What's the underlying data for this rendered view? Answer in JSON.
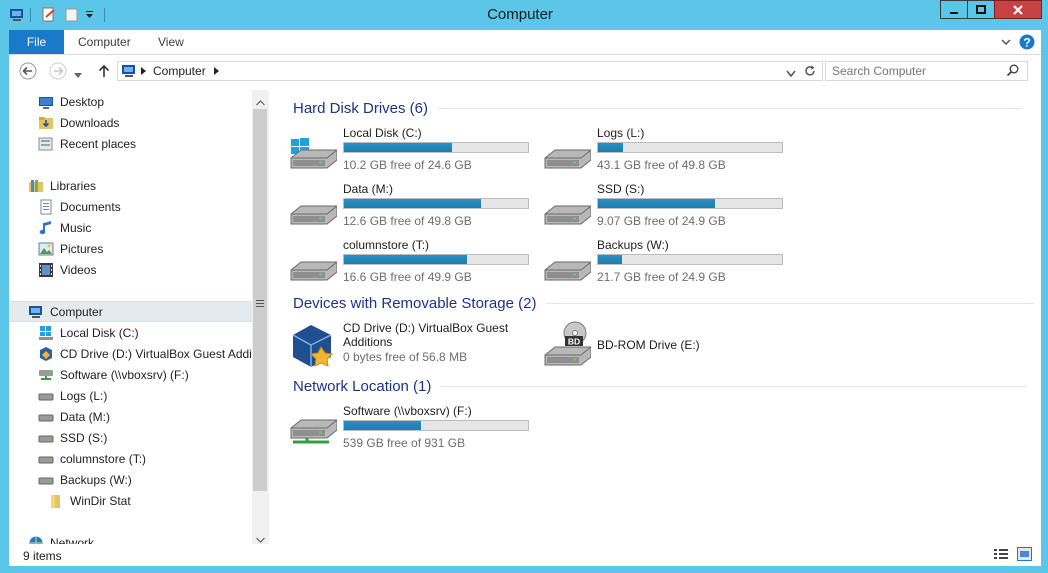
{
  "window": {
    "title": "Computer"
  },
  "ribbon": {
    "file": "File",
    "tabs": [
      "Computer",
      "View"
    ]
  },
  "address": {
    "location": "Computer"
  },
  "search": {
    "placeholder": "Search Computer"
  },
  "nav": {
    "favorites": [
      "Desktop",
      "Downloads",
      "Recent places"
    ],
    "libraries_label": "Libraries",
    "libraries": [
      "Documents",
      "Music",
      "Pictures",
      "Videos"
    ],
    "computer_label": "Computer",
    "drives": [
      "Local Disk (C:)",
      "CD Drive (D:) VirtualBox Guest Additi",
      "Software (\\\\vboxsrv) (F:)",
      "Logs (L:)",
      "Data (M:)",
      "SSD (S:)",
      "columnstore (T:)",
      "Backups (W:)"
    ],
    "subfolder": "WinDir Stat",
    "network_label": "Network"
  },
  "groups": {
    "hdd_title": "Hard Disk Drives (6)",
    "removable_title": "Devices with Removable Storage (2)",
    "network_title": "Network Location (1)"
  },
  "hdd": [
    {
      "name": "Local Disk (C:)",
      "free": "10.2 GB free of 24.6 GB",
      "used_fraction": 0.585
    },
    {
      "name": "Logs (L:)",
      "free": "43.1 GB free of 49.8 GB",
      "used_fraction": 0.135
    },
    {
      "name": "Data (M:)",
      "free": "12.6 GB free of 49.8 GB",
      "used_fraction": 0.747
    },
    {
      "name": "SSD (S:)",
      "free": "9.07 GB free of 24.9 GB",
      "used_fraction": 0.636
    },
    {
      "name": "columnstore (T:)",
      "free": "16.6 GB free of 49.9 GB",
      "used_fraction": 0.667
    },
    {
      "name": "Backups (W:)",
      "free": "21.7 GB free of 24.9 GB",
      "used_fraction": 0.129
    }
  ],
  "removable": [
    {
      "name_line1": "CD Drive (D:) VirtualBox Guest",
      "name_line2": "Additions",
      "free": "0 bytes free of 56.8 MB"
    },
    {
      "name": "BD-ROM Drive (E:)",
      "badge": "BD"
    }
  ],
  "network": [
    {
      "name": "Software (\\\\vboxsrv) (F:)",
      "free": "539 GB free of 931 GB",
      "used_fraction": 0.421
    }
  ],
  "status": {
    "items": "9 items"
  },
  "colors": {
    "accent": "#1979ca",
    "frame": "#5bc6e8",
    "bar_fill": "#1a7fb0",
    "group_title": "#1e3287"
  },
  "icons": [
    "computer-icon",
    "properties-icon",
    "new-folder-icon",
    "dropdown-icon",
    "minimize-icon",
    "maximize-icon",
    "close-icon",
    "help-icon",
    "back-icon",
    "forward-icon",
    "up-icon",
    "refresh-icon",
    "search-icon",
    "hard-drive-icon",
    "dvd-drive-icon",
    "network-drive-icon",
    "details-view-icon",
    "large-icons-view-icon"
  ]
}
